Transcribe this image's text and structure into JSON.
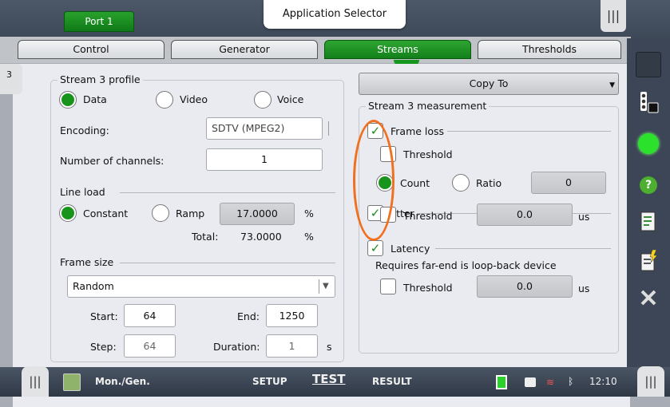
{
  "header": {
    "app_selector": "Application Selector",
    "port_tab": "Port 1",
    "menu_glyph": "|||"
  },
  "tabs": [
    {
      "label": "Control"
    },
    {
      "label": "Generator"
    },
    {
      "label": "Streams"
    },
    {
      "label": "Thresholds"
    }
  ],
  "active_tab": "Streams",
  "left_handle": "3",
  "profile": {
    "title": "Stream 3 profile",
    "types": [
      "Data",
      "Video",
      "Voice"
    ],
    "selected_type": "Data",
    "encoding_label": "Encoding:",
    "encoding_value": "SDTV (MPEG2)",
    "channels_label": "Number of channels:",
    "channels_value": "1",
    "line_load": {
      "title": "Line load",
      "modes": [
        "Constant",
        "Ramp"
      ],
      "selected": "Constant",
      "value": "17.0000",
      "unit": "%",
      "total_label": "Total:",
      "total_value": "73.0000",
      "total_unit": "%"
    },
    "frame_size": {
      "title": "Frame size",
      "mode": "Random",
      "start_label": "Start:",
      "start": "64",
      "end_label": "End:",
      "end": "1250",
      "step_label": "Step:",
      "step": "64",
      "duration_label": "Duration:",
      "duration": "1",
      "duration_unit": "s"
    }
  },
  "copy_to": "Copy To",
  "measurement": {
    "title": "Stream 3 measurement",
    "frame_loss": {
      "label": "Frame loss",
      "checked": true,
      "threshold_label": "Threshold",
      "threshold_checked": false,
      "modes": [
        "Count",
        "Ratio"
      ],
      "selected": "Count",
      "value": "0"
    },
    "jitter": {
      "label": "Jitter",
      "checked": true,
      "threshold_label": "Threshold",
      "threshold_checked": false,
      "value": "0.0",
      "unit": "us"
    },
    "latency": {
      "label": "Latency",
      "checked": true,
      "note": "Requires far-end is loop-back device",
      "threshold_label": "Threshold",
      "threshold_checked": false,
      "value": "0.0",
      "unit": "us"
    }
  },
  "bottom": {
    "app_name": "Mon./Gen.",
    "setup": "SETUP",
    "test": "TEST",
    "result": "RESULT",
    "clock": "12:10"
  },
  "colors": {
    "accent_green": "#18941c",
    "annotation": "#f07020",
    "bar_dark": "#3c4656"
  }
}
